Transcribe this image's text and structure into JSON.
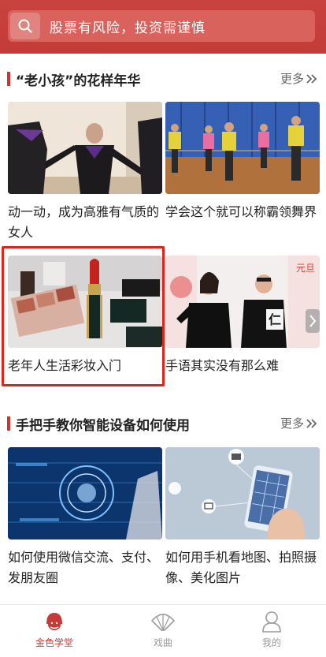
{
  "search": {
    "placeholder": "股票有风险，投资需谨慎"
  },
  "sections": [
    {
      "title": "“老小孩”的花样年华",
      "more": "更多",
      "cards": [
        {
          "caption": "动一动，成为高雅有气质的女人"
        },
        {
          "caption": "学会这个就可以称霸领舞界"
        },
        {
          "caption": "老年人生活彩妆入门"
        },
        {
          "caption": "手语其实没有那么难"
        }
      ]
    },
    {
      "title": "手把手教你智能设备如何使用",
      "more": "更多",
      "cards": [
        {
          "caption": "如何使用微信交流、支付、发朋友圈"
        },
        {
          "caption": "如何用手机看地图、拍照摄像、美化图片"
        }
      ]
    }
  ],
  "thumb_text": {
    "sign_char": "仁",
    "sign_banner": "元旦"
  },
  "tabs": [
    {
      "label": "金色学堂",
      "active": true
    },
    {
      "label": "戏曲",
      "active": false
    },
    {
      "label": "我的",
      "active": false
    }
  ],
  "colors": {
    "brand": "#c43b37",
    "highlight": "#e0241c",
    "inactive": "#9a9a9a"
  }
}
